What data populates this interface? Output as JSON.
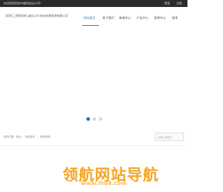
{
  "topbar": {
    "welcome": "欢迎来到西安市顺凯宏运公司！",
    "links": [
      "登录",
      "注册"
    ]
  },
  "header": {
    "logo_text": "家贸汇_律师咨询_诚信公司-杭州永稳商贸有限公司"
  },
  "nav": {
    "items": [
      "网站首页",
      "关于我们",
      "新闻中心",
      "产品中心",
      "案例中心",
      "联系"
    ],
    "active_index": 0
  },
  "banner": {
    "dots": 3,
    "active_dot": 0
  },
  "breadcrumb": {
    "items": [
      "您的位置：首页",
      "网站首页",
      "精彩推荐"
    ]
  },
  "search": {
    "placeholder": "请输入关键字"
  },
  "watermark": {
    "text": "领航网站导航",
    "sub": "www.lh84.com"
  },
  "colors": {
    "topbar_bg": "#2b2b2b",
    "accent": "#1a73c9",
    "dot_active": "#1f5fa8",
    "watermark": "#f3a524"
  }
}
